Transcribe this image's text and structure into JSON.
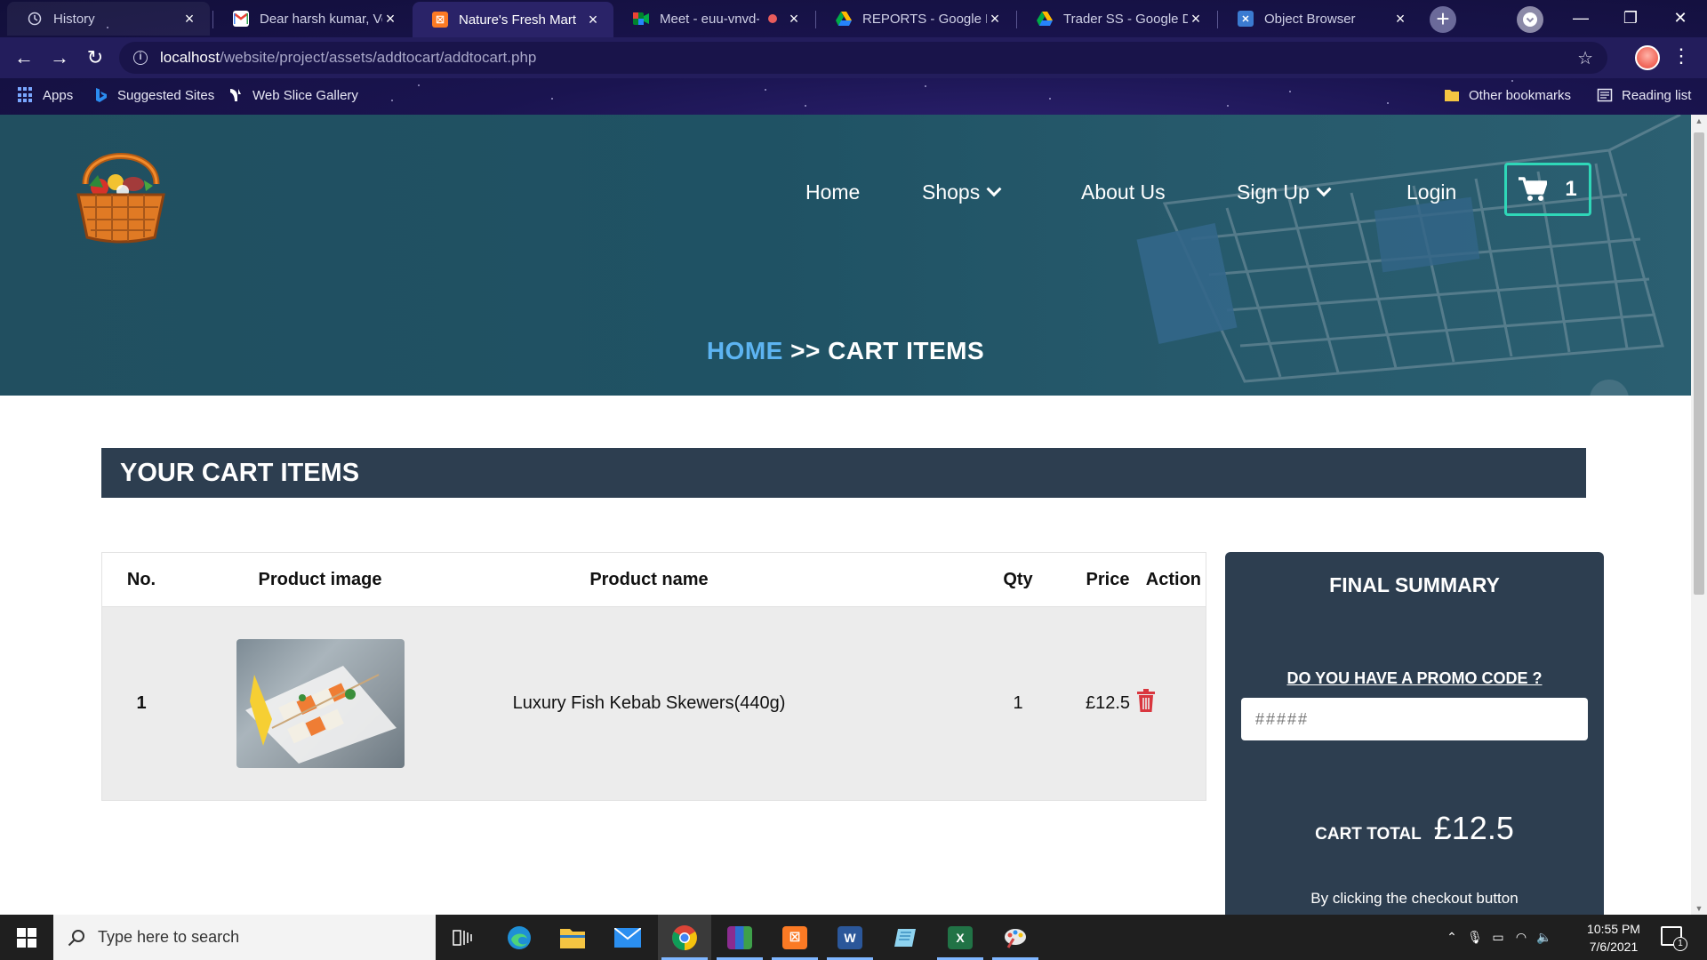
{
  "browser": {
    "tabs": [
      {
        "title": "History",
        "icon": "history-icon"
      },
      {
        "title": "Dear harsh kumar, Ver",
        "icon": "gmail-icon"
      },
      {
        "title": "Nature's Fresh Mart",
        "icon": "xampp-icon",
        "active": true
      },
      {
        "title": "Meet - euu-vnvd-",
        "icon": "meet-icon"
      },
      {
        "title": "REPORTS - Google Dr",
        "icon": "drive-icon"
      },
      {
        "title": "Trader SS - Google Dri",
        "icon": "drive-icon"
      },
      {
        "title": "Object Browser",
        "icon": "minio-icon"
      }
    ],
    "url_host": "localhost",
    "url_path": "/website/project/assets/addtocart/addtocart.php",
    "bookmarks": [
      {
        "label": "Apps"
      },
      {
        "label": "Suggested Sites"
      },
      {
        "label": "Web Slice Gallery"
      }
    ],
    "other_bookmarks": "Other bookmarks",
    "reading_list": "Reading list"
  },
  "site": {
    "nav": {
      "home": "Home",
      "shops": "Shops",
      "about": "About Us",
      "signup": "Sign Up",
      "login": "Login",
      "cart_count": "1"
    },
    "breadcrumb": {
      "home": "HOME",
      "sep": ">>",
      "current": "CART ITEMS"
    },
    "section_title": "YOUR CART ITEMS",
    "table": {
      "headers": [
        "No.",
        "Product image",
        "Product name",
        "Qty",
        "Price",
        "Action"
      ],
      "rows": [
        {
          "no": "1",
          "name": "Luxury Fish Kebab Skewers(440g)",
          "qty": "1",
          "price": "£12.5"
        }
      ]
    },
    "summary": {
      "title": "FINAL SUMMARY",
      "promo_question": "DO YOU HAVE A PROMO CODE ?",
      "promo_placeholder": "#####",
      "total_label": "CART TOTAL",
      "total_value": "£12.5",
      "checkout_note": "By clicking the checkout button"
    },
    "colors": {
      "accent_blue": "#5db4f2",
      "cart_border": "#2fd7b8",
      "panel": "#2d3e50",
      "delete": "#d9363e"
    }
  },
  "taskbar": {
    "search_placeholder": "Type here to search",
    "time": "10:55 PM",
    "date": "7/6/2021",
    "notification_count": "1"
  }
}
